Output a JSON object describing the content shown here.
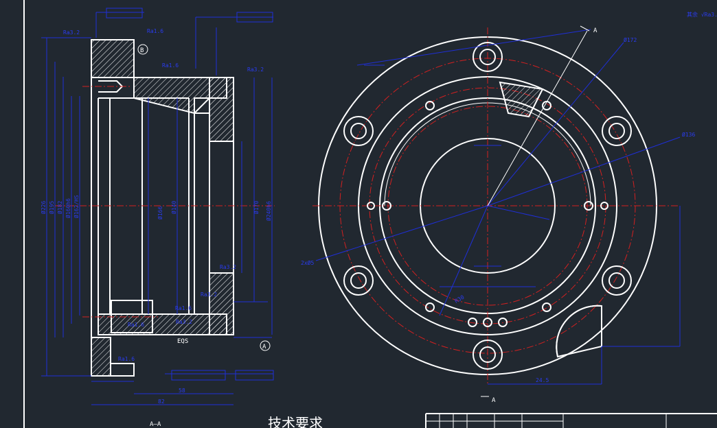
{
  "section": {
    "label": "A—A",
    "eqs_note": "EQS",
    "datum_a": "A",
    "datum_b": "B",
    "roughness_labels": [
      "Ra3.2",
      "Ra1.6",
      "Ra3.2",
      "Ra1.6",
      "Ra3.2",
      "Ra1.6",
      "Ra3.2",
      "Ra1.6",
      "Ra1.6",
      "Ra3.2"
    ],
    "dims_vertical": [
      "Ø226",
      "Ø195",
      "Ø182",
      "Ø160h6",
      "Ø162/HS",
      "Ø166",
      "Ø140",
      "Ø170",
      "Ø240h6"
    ],
    "dims_bottom": [
      "58",
      "82"
    ]
  },
  "plan": {
    "dim_d172": "Ø172",
    "dim_d136": "Ø136",
    "note_holes": "2xØ5",
    "label_a_top": "A",
    "label_a_bottom": "A",
    "radius_label": "R30",
    "bottom_dim": "24.5"
  },
  "notes": {
    "heading": "技术要求",
    "top_right": "其余 √Ra3.2"
  }
}
